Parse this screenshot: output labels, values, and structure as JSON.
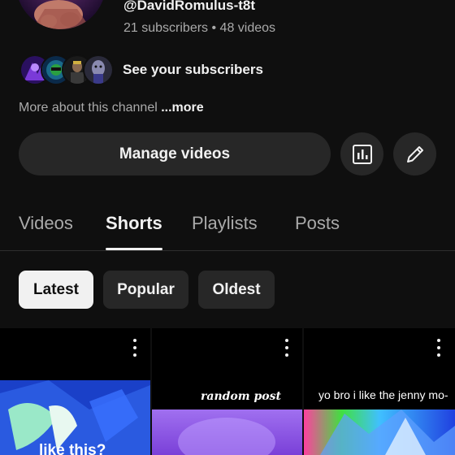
{
  "channel": {
    "handle": "@DavidRomulus-t8t",
    "stats": "21 subscribers • 48 videos"
  },
  "subscribers": {
    "label": "See your subscribers"
  },
  "about": {
    "prefix": "More about this channel ",
    "more": "...more"
  },
  "actions": {
    "manage_label": "Manage videos",
    "analytics_icon": "analytics-icon",
    "edit_icon": "pencil-icon"
  },
  "tabs": [
    {
      "label": "Videos"
    },
    {
      "label": "Shorts"
    },
    {
      "label": "Playlists"
    },
    {
      "label": "Posts"
    }
  ],
  "active_tab": "Shorts",
  "sort_chips": [
    {
      "label": "Latest"
    },
    {
      "label": "Popular"
    },
    {
      "label": "Oldest"
    }
  ],
  "selected_chip": "Latest",
  "shorts": [
    {
      "caption": "like this?"
    },
    {
      "caption": "random post"
    },
    {
      "caption": "yo bro i like the jenny mo-"
    }
  ],
  "colors": {
    "background": "#0f0f0f",
    "surface": "#272727",
    "text_primary": "#f1f1f1",
    "text_secondary": "#aaaaaa"
  }
}
